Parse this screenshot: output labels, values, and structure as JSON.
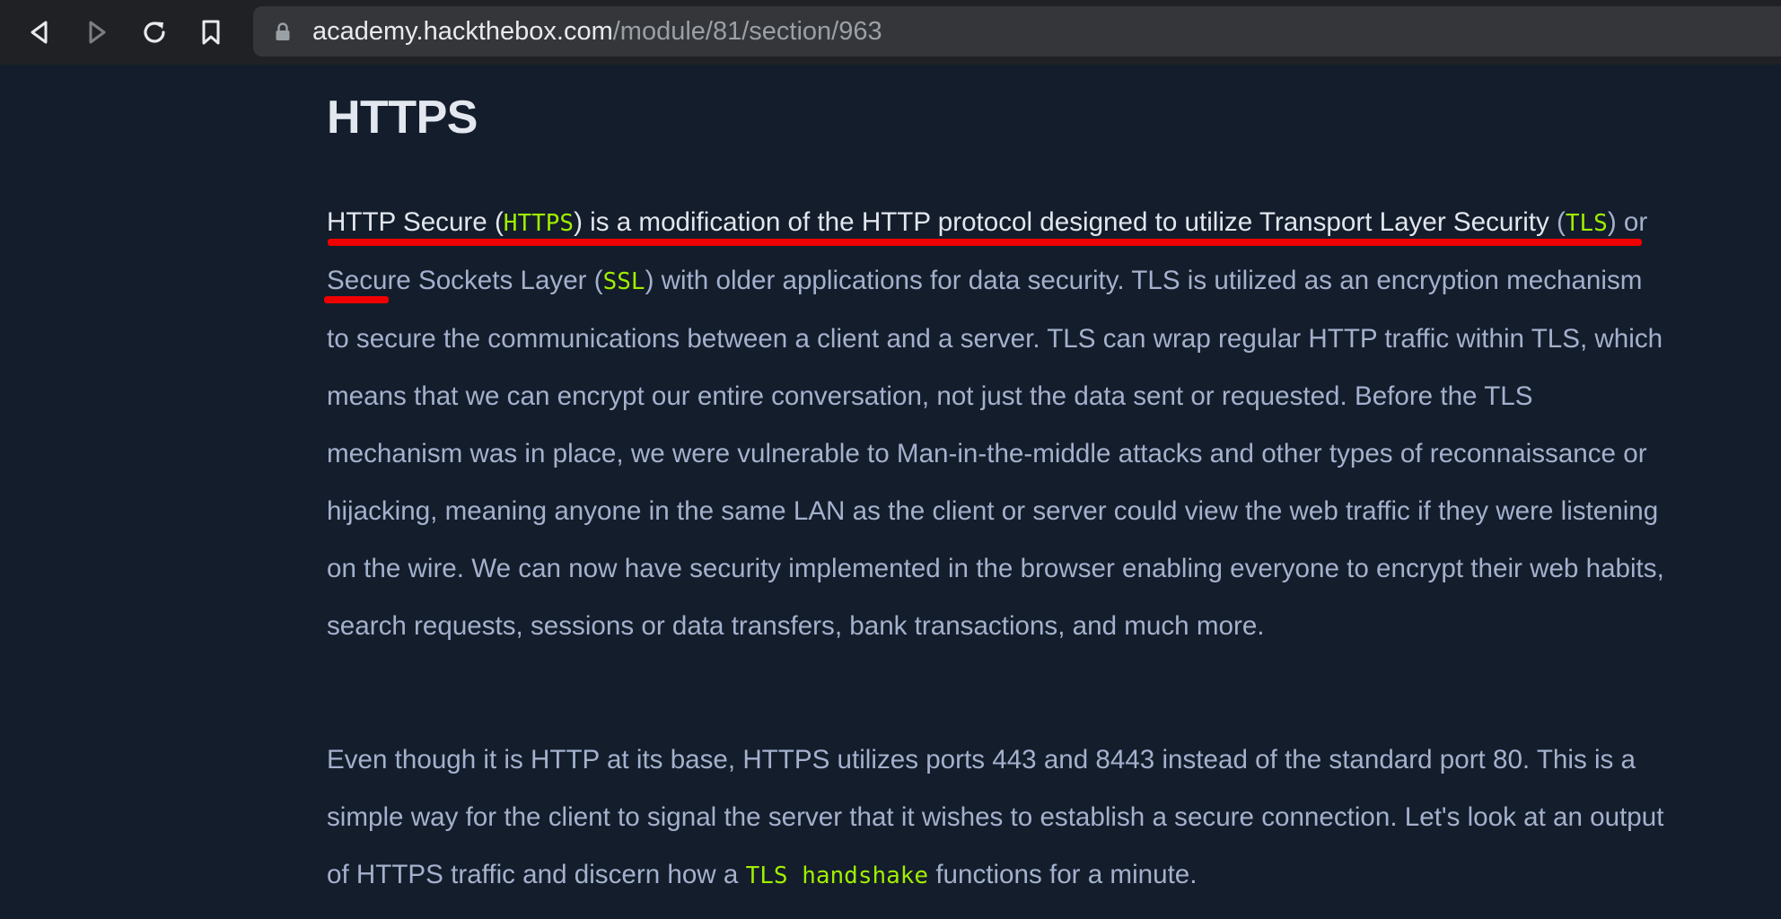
{
  "browser": {
    "url_host": "academy.hackthebox.com",
    "url_path": "/module/81/section/963"
  },
  "page": {
    "title": "HTTPS",
    "p1": {
      "s1": "HTTP Secure (",
      "c1": "HTTPS",
      "s2": ") is a modification of the HTTP protocol designed to utilize Transport Layer Security",
      "s3": " (",
      "c2": "TLS",
      "s4": ") or Secure Sockets Layer (",
      "c3": "SSL",
      "s5": ") with older applications for data security. TLS is utilized as an encryption mechanism to secure the communications between a client and a server. TLS can wrap regular HTTP traffic within TLS, which means that we can encrypt our entire conversation, not just the data sent or requested. Before the TLS mechanism was in place, we were vulnerable to Man-in-the-middle attacks and other types of reconnaissance or hijacking, meaning anyone in the same LAN as the client or server could view the web traffic if they were listening on the wire. We can now have security implemented in the browser enabling everyone to encrypt their web habits, search requests, sessions or data transfers, bank transactions, and much more."
    },
    "p2": {
      "s1": "Even though it is HTTP at its base, HTTPS utilizes ports 443 and 8443 instead of the standard port 80. This is a simple way for the client to signal the server that it wishes to establish a secure connection. Let's look at an output of HTTPS traffic and discern how a ",
      "c1": "TLS handshake",
      "s2": " functions for a minute."
    }
  },
  "colors": {
    "background": "#141d2b",
    "body_text": "#a4b1cd",
    "code": "#9fef00",
    "annotation": "#ef0000"
  }
}
